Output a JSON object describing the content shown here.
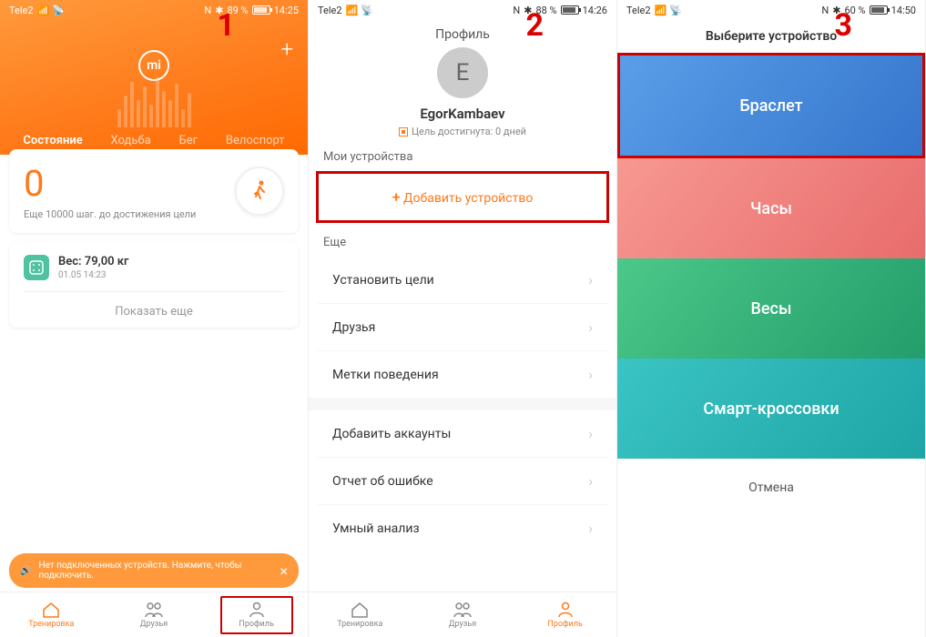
{
  "phone1": {
    "step_label": "1",
    "status": {
      "carrier": "Tele2",
      "nfc": "N",
      "bt": "✱",
      "battery": "89 %",
      "time": "14:25"
    },
    "plus": "+",
    "logo": "mi",
    "tabs": [
      "Состояние",
      "Ходьба",
      "Бег",
      "Велоспорт"
    ],
    "steps": {
      "count": "0",
      "sub": "Еще 10000 шаг. до достижения цели"
    },
    "weight": {
      "label": "Вес: 79,00  кг",
      "date": "01.05 14:23"
    },
    "show_more": "Показать еще",
    "snack": "Нет подключенных устройств. Нажмите, чтобы подключить.",
    "nav": [
      "Тренировка",
      "Друзья",
      "Профиль"
    ]
  },
  "phone2": {
    "step_label": "2",
    "status": {
      "carrier": "Tele2",
      "nfc": "N",
      "bt": "✱",
      "battery": "88 %",
      "time": "14:26"
    },
    "title": "Профиль",
    "avatar_letter": "E",
    "username": "EgorKambaev",
    "goal": "Цель достигнута: 0 дней",
    "my_devices": "Мои устройства",
    "add_device": "Добавить устройство",
    "more_label": "Еще",
    "list1": [
      "Установить цели",
      "Друзья",
      "Метки поведения"
    ],
    "list2": [
      "Добавить аккаунты",
      "Отчет об ошибке",
      "Умный анализ"
    ],
    "nav": [
      "Тренировка",
      "Друзья",
      "Профиль"
    ]
  },
  "phone3": {
    "step_label": "3",
    "status": {
      "carrier": "Tele2",
      "nfc": "N",
      "bt": "✱",
      "battery": "60 %",
      "time": "14:50"
    },
    "title": "Выберите устройство",
    "devices": [
      "Браслет",
      "Часы",
      "Весы",
      "Смарт-кроссовки"
    ],
    "cancel": "Отмена"
  }
}
